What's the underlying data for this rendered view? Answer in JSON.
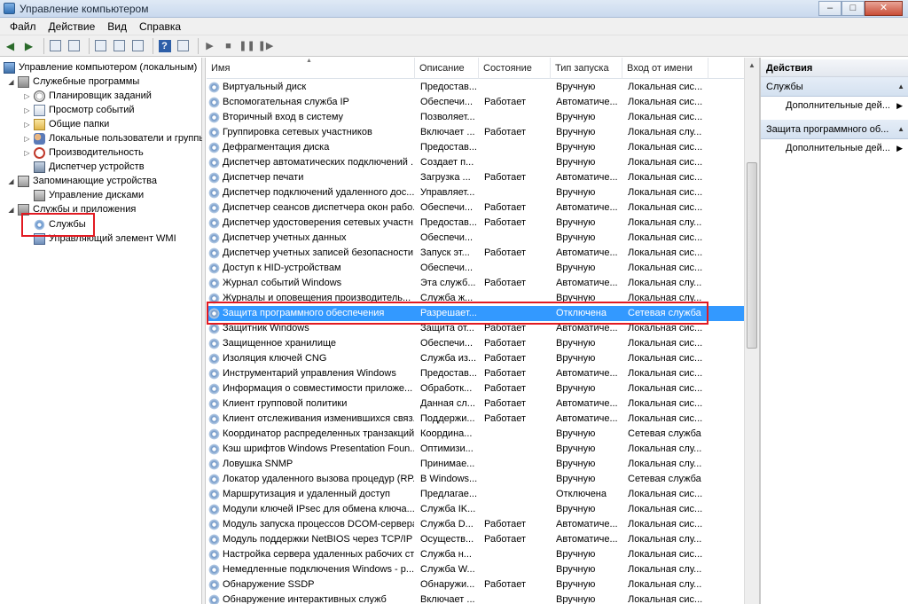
{
  "window": {
    "title": "Управление компьютером",
    "minimize": "–",
    "maximize": "□",
    "close": "✕"
  },
  "menu": [
    "Файл",
    "Действие",
    "Вид",
    "Справка"
  ],
  "tree": [
    {
      "label": "Управление компьютером (локальным)",
      "icon": "computer-icon"
    },
    {
      "label": "Служебные программы",
      "icon": "tools-icon"
    },
    {
      "label": "Планировщик заданий",
      "icon": "clock-icon"
    },
    {
      "label": "Просмотр событий",
      "icon": "event-viewer-icon"
    },
    {
      "label": "Общие папки",
      "icon": "folder-icon"
    },
    {
      "label": "Локальные пользователи и группы",
      "icon": "users-icon"
    },
    {
      "label": "Производительность",
      "icon": "performance-icon"
    },
    {
      "label": "Диспетчер устройств",
      "icon": "device-manager-icon"
    },
    {
      "label": "Запоминающие устройства",
      "icon": "storage-icon"
    },
    {
      "label": "Управление дисками",
      "icon": "disk-icon"
    },
    {
      "label": "Службы и приложения",
      "icon": "services-apps-icon"
    },
    {
      "label": "Службы",
      "icon": "services-gear-icon"
    },
    {
      "label": "Управляющий элемент WMI",
      "icon": "wmi-icon"
    }
  ],
  "columns": [
    "Имя",
    "Описание",
    "Состояние",
    "Тип запуска",
    "Вход от имени"
  ],
  "services": [
    [
      "Виртуальный диск",
      "Предостав...",
      "",
      "Вручную",
      "Локальная сис..."
    ],
    [
      "Вспомогательная служба IP",
      "Обеспечи...",
      "Работает",
      "Автоматиче...",
      "Локальная сис..."
    ],
    [
      "Вторичный вход в систему",
      "Позволяет...",
      "",
      "Вручную",
      "Локальная сис..."
    ],
    [
      "Группировка сетевых участников",
      "Включает ...",
      "Работает",
      "Вручную",
      "Локальная слу..."
    ],
    [
      "Дефрагментация диска",
      "Предостав...",
      "",
      "Вручную",
      "Локальная сис..."
    ],
    [
      "Диспетчер автоматических подключений ...",
      "Создает п...",
      "",
      "Вручную",
      "Локальная сис..."
    ],
    [
      "Диспетчер печати",
      "Загрузка ...",
      "Работает",
      "Автоматиче...",
      "Локальная сис..."
    ],
    [
      "Диспетчер подключений удаленного дос...",
      "Управляет...",
      "",
      "Вручную",
      "Локальная сис..."
    ],
    [
      "Диспетчер сеансов диспетчера окон рабо...",
      "Обеспечи...",
      "Работает",
      "Автоматиче...",
      "Локальная сис..."
    ],
    [
      "Диспетчер удостоверения сетевых участн...",
      "Предостав...",
      "Работает",
      "Вручную",
      "Локальная слу..."
    ],
    [
      "Диспетчер учетных данных",
      "Обеспечи...",
      "",
      "Вручную",
      "Локальная сис..."
    ],
    [
      "Диспетчер учетных записей безопасности",
      "Запуск эт...",
      "Работает",
      "Автоматиче...",
      "Локальная сис..."
    ],
    [
      "Доступ к HID-устройствам",
      "Обеспечи...",
      "",
      "Вручную",
      "Локальная сис..."
    ],
    [
      "Журнал событий Windows",
      "Эта служб...",
      "Работает",
      "Автоматиче...",
      "Локальная слу..."
    ],
    [
      "Журналы и оповещения производитель...",
      "Служба ж...",
      "",
      "Вручную",
      "Локальная слу..."
    ],
    [
      "Защита программного обеспечения",
      "Разрешает...",
      "",
      "Отключена",
      "Сетевая служба"
    ],
    [
      "Защитник Windows",
      "Защита от...",
      "Работает",
      "Автоматиче...",
      "Локальная сис..."
    ],
    [
      "Защищенное хранилище",
      "Обеспечи...",
      "Работает",
      "Вручную",
      "Локальная сис..."
    ],
    [
      "Изоляция ключей CNG",
      "Служба из...",
      "Работает",
      "Вручную",
      "Локальная сис..."
    ],
    [
      "Инструментарий управления Windows",
      "Предостав...",
      "Работает",
      "Автоматиче...",
      "Локальная сис..."
    ],
    [
      "Информация о совместимости приложе...",
      "Обработк...",
      "Работает",
      "Вручную",
      "Локальная сис..."
    ],
    [
      "Клиент групповой политики",
      "Данная сл...",
      "Работает",
      "Автоматиче...",
      "Локальная сис..."
    ],
    [
      "Клиент отслеживания изменившихся связ...",
      "Поддержи...",
      "Работает",
      "Автоматиче...",
      "Локальная сис..."
    ],
    [
      "Координатор распределенных транзакций",
      "Координа...",
      "",
      "Вручную",
      "Сетевая служба"
    ],
    [
      "Кэш шрифтов Windows Presentation Foun...",
      "Оптимизи...",
      "",
      "Вручную",
      "Локальная слу..."
    ],
    [
      "Ловушка SNMP",
      "Принимае...",
      "",
      "Вручную",
      "Локальная слу..."
    ],
    [
      "Локатор удаленного вызова процедур (RP...",
      "В Windows...",
      "",
      "Вручную",
      "Сетевая служба"
    ],
    [
      "Маршрутизация и удаленный доступ",
      "Предлагае...",
      "",
      "Отключена",
      "Локальная сис..."
    ],
    [
      "Модули ключей IPsec для обмена ключа...",
      "Служба IK...",
      "",
      "Вручную",
      "Локальная сис..."
    ],
    [
      "Модуль запуска процессов DCOM-сервера",
      "Служба D...",
      "Работает",
      "Автоматиче...",
      "Локальная сис..."
    ],
    [
      "Модуль поддержки NetBIOS через TCP/IP",
      "Осуществ...",
      "Работает",
      "Автоматиче...",
      "Локальная слу..."
    ],
    [
      "Настройка сервера удаленных рабочих ст...",
      "Служба н...",
      "",
      "Вручную",
      "Локальная сис..."
    ],
    [
      "Немедленные подключения Windows - р...",
      "Служба W...",
      "",
      "Вручную",
      "Локальная слу..."
    ],
    [
      "Обнаружение SSDP",
      "Обнаружи...",
      "Работает",
      "Вручную",
      "Локальная слу..."
    ],
    [
      "Обнаружение интерактивных служб",
      "Включает ...",
      "",
      "Вручную",
      "Локальная сис..."
    ]
  ],
  "selected_row": 15,
  "actions": {
    "header": "Действия",
    "section1": "Службы",
    "item1": "Дополнительные дей...",
    "section2": "Защита программного об...",
    "item2": "Дополнительные дей..."
  },
  "colors": {
    "selection": "#3399ff",
    "highlight_box": "#e21a22"
  }
}
